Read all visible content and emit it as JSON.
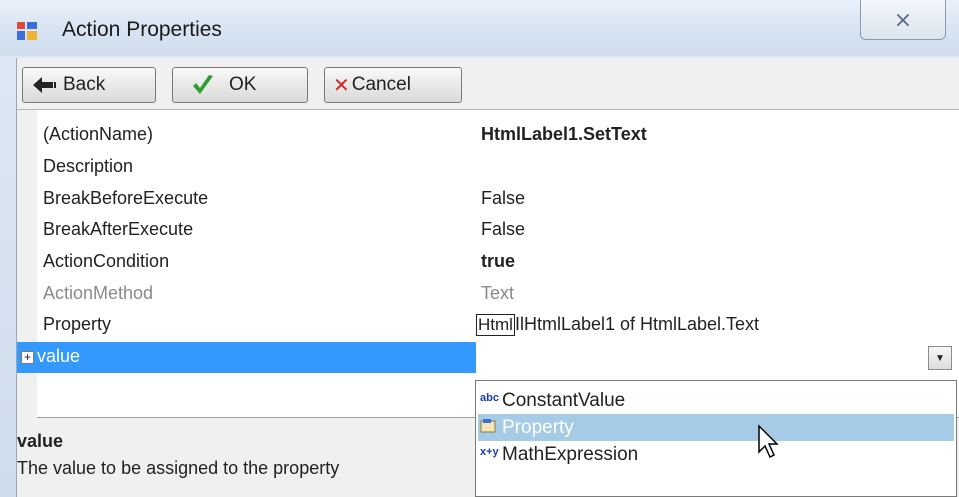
{
  "window": {
    "title": "Action Properties",
    "close_label": "⨯"
  },
  "toolbar": {
    "back_label": "Back",
    "ok_label": "OK",
    "cancel_label": "Cancel"
  },
  "grid": {
    "rows": [
      {
        "name": "(ActionName)",
        "value": "HtmlLabel1.SetText",
        "bold": true
      },
      {
        "name": "Description",
        "value": ""
      },
      {
        "name": "BreakBeforeExecute",
        "value": "False"
      },
      {
        "name": "BreakAfterExecute",
        "value": "False"
      },
      {
        "name": "ActionCondition",
        "value": "true",
        "bold": true
      },
      {
        "name": "ActionMethod",
        "value": "Text",
        "disabled": true
      },
      {
        "name": "Property",
        "value_box": "Html",
        "value_prefix": "Il",
        "value": "HtmlLabel1 of HtmlLabel.Text"
      },
      {
        "name": "value",
        "value": "",
        "selected": true
      }
    ],
    "expand_glyph": "+"
  },
  "dropdown": {
    "items": [
      {
        "icon": "abc",
        "label": "ConstantValue"
      },
      {
        "icon": "prop",
        "label": "Property",
        "highlighted": true
      },
      {
        "icon": "x+y",
        "label": "MathExpression"
      }
    ]
  },
  "description": {
    "title": "value",
    "text": "The value to be assigned to the property"
  },
  "colors": {
    "selection": "#3399ff",
    "dropdown_highlight": "#a6cbe6"
  }
}
